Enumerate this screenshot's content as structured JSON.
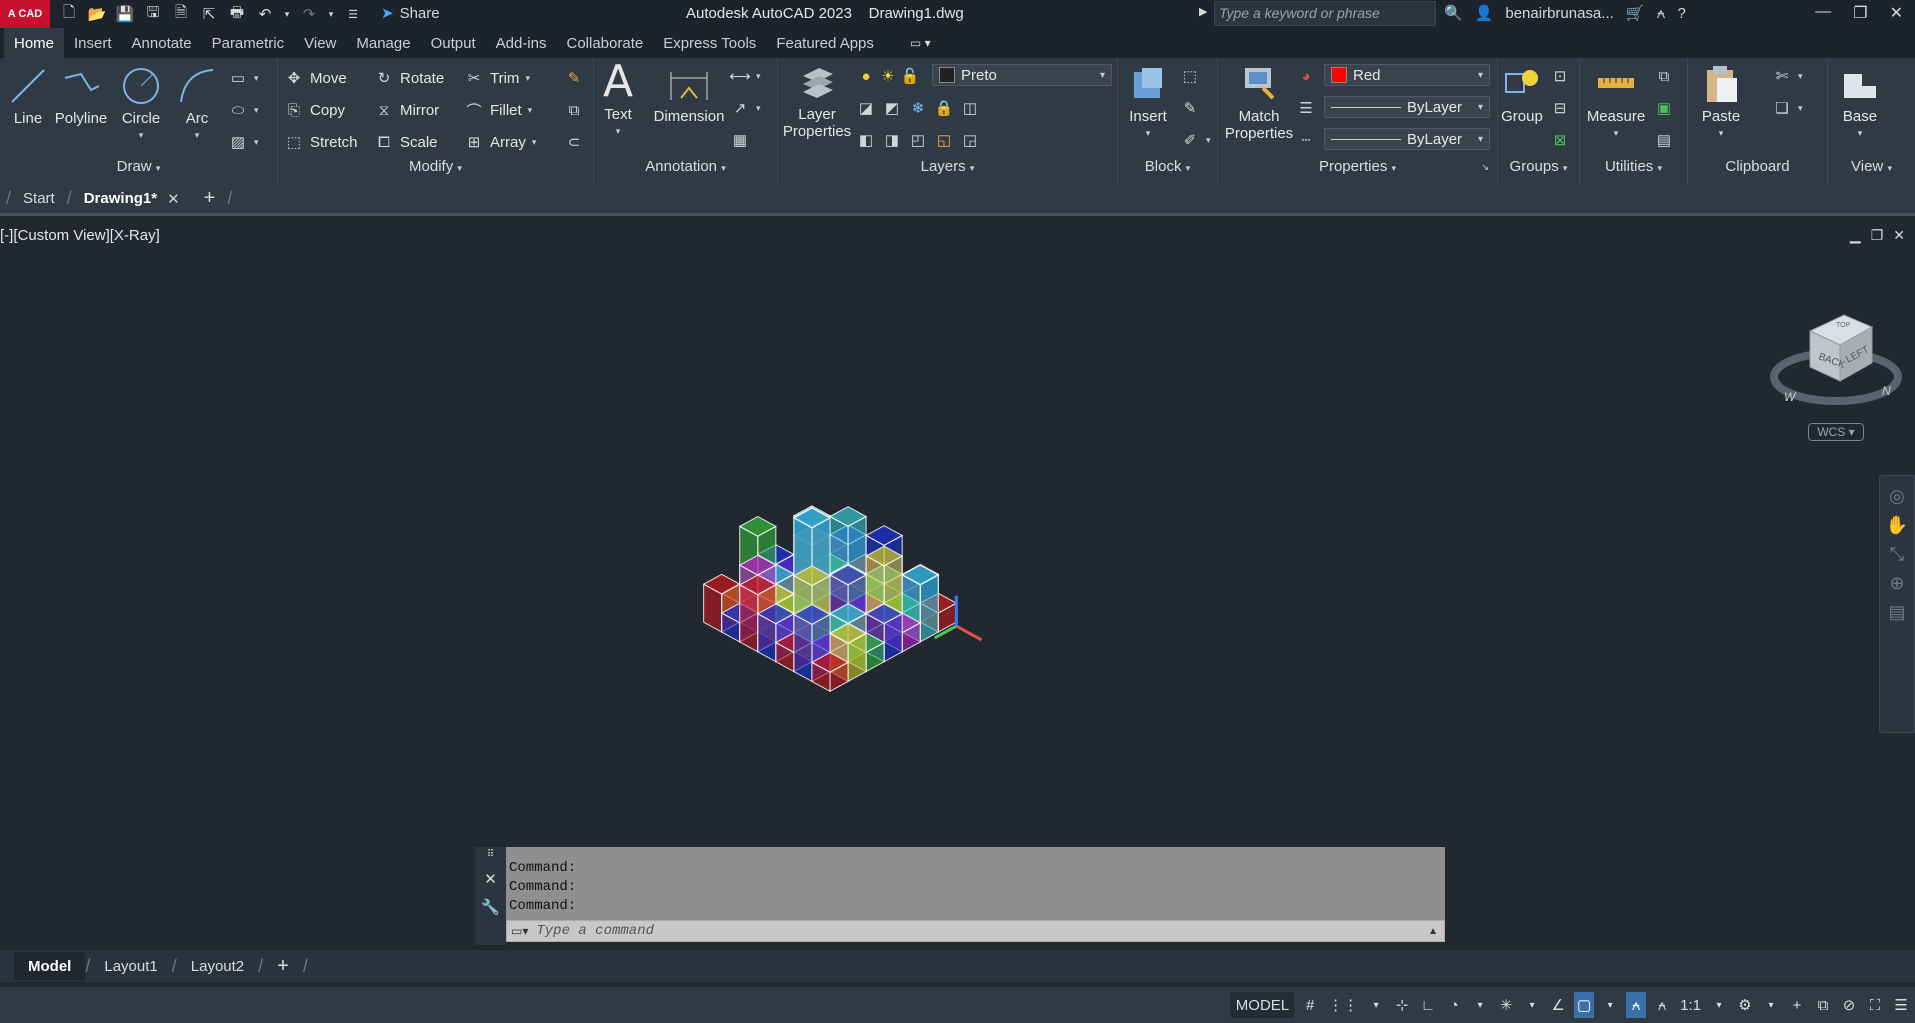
{
  "app": {
    "logo": "A CAD",
    "title": "Autodesk AutoCAD 2023    Drawing1.dwg",
    "share_label": "Share",
    "search_placeholder": "Type a keyword or phrase",
    "user": "benairbrunasa..."
  },
  "ribbon_tabs": [
    "Home",
    "Insert",
    "Annotate",
    "Parametric",
    "View",
    "Manage",
    "Output",
    "Add-ins",
    "Collaborate",
    "Express Tools",
    "Featured Apps"
  ],
  "active_ribbon_tab": "Home",
  "ribbon": {
    "draw": {
      "title": "Draw",
      "line": "Line",
      "polyline": "Polyline",
      "circle": "Circle",
      "arc": "Arc"
    },
    "modify": {
      "title": "Modify",
      "move": "Move",
      "rotate": "Rotate",
      "trim": "Trim",
      "copy": "Copy",
      "mirror": "Mirror",
      "fillet": "Fillet",
      "stretch": "Stretch",
      "scale": "Scale",
      "array": "Array"
    },
    "annotation": {
      "title": "Annotation",
      "text": "Text",
      "dimension": "Dimension"
    },
    "layers": {
      "title": "Layers",
      "layer_properties_1": "Layer",
      "layer_properties_2": "Properties",
      "current_layer": "Preto"
    },
    "block": {
      "title": "Block",
      "insert": "Insert"
    },
    "properties": {
      "title": "Properties",
      "match_1": "Match",
      "match_2": "Properties",
      "color": "Red",
      "color_hex": "#ff0000",
      "lineweight": "ByLayer",
      "linetype": "ByLayer"
    },
    "groups": {
      "title": "Groups",
      "group": "Group"
    },
    "utilities": {
      "title": "Utilities",
      "measure": "Measure"
    },
    "clipboard": {
      "title": "Clipboard",
      "paste": "Paste"
    },
    "view": {
      "title": "View",
      "base": "Base"
    }
  },
  "file_tabs": {
    "start": "Start",
    "drawing": "Drawing1*"
  },
  "viewport": {
    "label": "[-][Custom View][X-Ray]",
    "wcs": "WCS",
    "viewcube_back": "BACK",
    "viewcube_left": "LEFT",
    "viewcube_top": "TOP",
    "compass_w": "W",
    "compass_n": "N"
  },
  "command": {
    "history": [
      "Command:",
      "Command:",
      "Command:"
    ],
    "placeholder": "Type a command"
  },
  "layout_tabs": [
    "Model",
    "Layout1",
    "Layout2"
  ],
  "status": {
    "model": "MODEL",
    "scale": "1:1"
  },
  "colors": {
    "accent": "#3b6fa8",
    "brand": "#c8102e",
    "red": "#c0171a",
    "yellow": "#c9c02a",
    "green": "#35b33a",
    "blue": "#1b2fd0",
    "magenta": "#b21fc2",
    "cyan": "#36bcc7"
  }
}
